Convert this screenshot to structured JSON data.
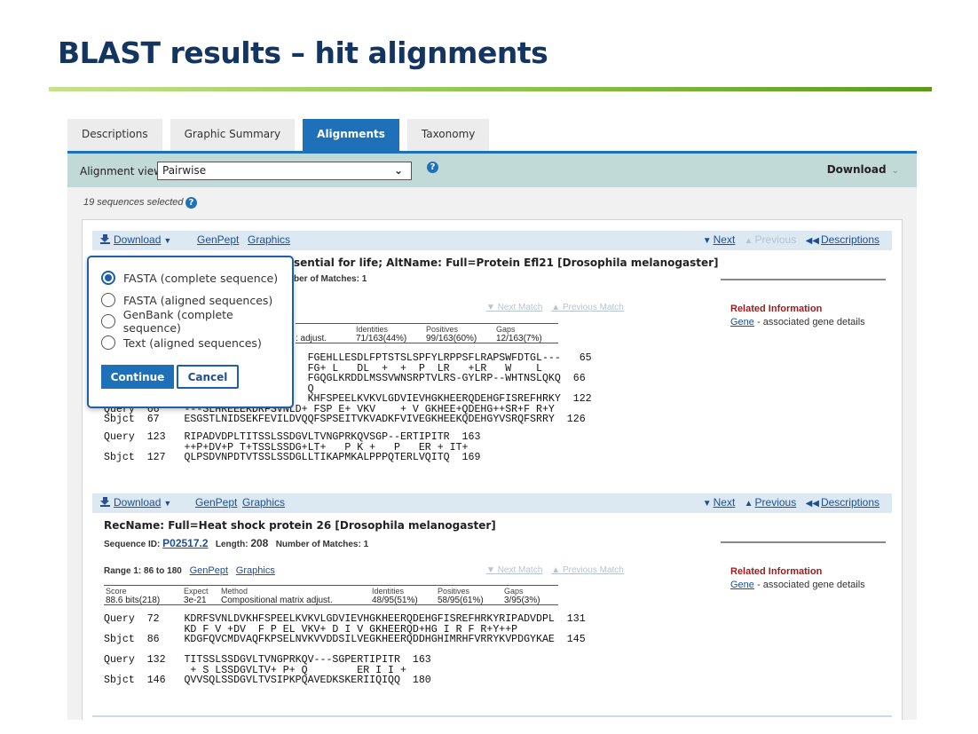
{
  "slide": {
    "title": "BLAST results – hit alignments"
  },
  "tabs": [
    {
      "label": "Descriptions",
      "active": false
    },
    {
      "label": "Graphic Summary",
      "active": false
    },
    {
      "label": "Alignments",
      "active": true
    },
    {
      "label": "Taxonomy",
      "active": false
    }
  ],
  "view_bar": {
    "label": "Alignment view",
    "selected": "Pairwise",
    "help_icon": "question-circle-icon",
    "download_label": "Download"
  },
  "selection": {
    "text": "19 sequences selected"
  },
  "hit_toolbar": {
    "download_label": "Download",
    "genpept_label": "GenPept",
    "graphics_label": "Graphics",
    "next_label": "Next",
    "previous_label": "Previous",
    "descriptions_label": "Descriptions"
  },
  "hits": [
    {
      "title_visible": "sential for life; AltName: Full=Protein Efl21 [Drosophila melanogaster]",
      "matches_label": "Number of Matches:",
      "matches_visible_prefix": "ber of Matches:",
      "matches": "1",
      "next_match": "Next Match",
      "previous_match": "Previous Match",
      "score_headers": {
        "identities": "Identities",
        "positives": "Positives",
        "gaps": "Gaps"
      },
      "method_partial": ": adjust.",
      "identities": "71/163(44%)",
      "positives": "99/163(60%)",
      "gaps": "12/163(7%)",
      "alignment_partial": [
        "                                 FGEHLLESDLFPTSTSLSPFYLRPPSFLRAPSWFDTGL---   65",
        "                                 FG+ L   DL  +  +  P  LR   +LR   W    L",
        "                                 FGQGLKRDDLMSSVWNSRPTVLRS-GYLRP--WHTNSLQKQ  66",
        "                                 Q",
        "                                 KHFSPEELKVKVLGDVIEVHGKHEERQDEHGFISREFHRKY  122",
        "Query  66    ---SLHREEEKDRFSVNLD+ FSP E+ VKV    + V GKHEE+QDEHG++SR+F R+Y",
        "Sbjct  67    ESGSTLNIDSEKFEVILDVQQFSPSEITVKVADKFVIVEGKHEEKQDEHGYVSRQFSRRY  126"
      ],
      "alignment_rest": [
        "Query  123   RIPADVDPLTITSSLSSDGVLTVNGPRKQVSGP--ERTIPITR  163",
        "             ++P+DV+P T+TSSLSSDG+LT+   P K +   P   ER + IT+",
        "Sbjct  127   QLPSDVNPDTVTSSLSSDGLLTIKAPMKALPPPQTERLVQITQ  169"
      ],
      "related": {
        "heading": "Related Information",
        "link": "Gene",
        "text": " - associated gene details"
      }
    },
    {
      "title": "RecName: Full=Heat shock protein 26 [Drosophila melanogaster]",
      "seq_id_label": "Sequence ID:",
      "seq_id": "P02517.2",
      "length_label": "Length:",
      "length": "208",
      "matches_label": "Number of Matches:",
      "matches": "1",
      "range": "Range 1: 86 to 180",
      "genpept_label": "GenPept",
      "graphics_label": "Graphics",
      "next_match": "Next Match",
      "previous_match": "Previous Match",
      "score_headers": {
        "score": "Score",
        "expect": "Expect",
        "method": "Method",
        "identities": "Identities",
        "positives": "Positives",
        "gaps": "Gaps"
      },
      "score": "88.6 bits(218)",
      "expect": "3e-21",
      "method": "Compositional matrix adjust.",
      "identities": "48/95(51%)",
      "positives": "58/95(61%)",
      "gaps": "3/95(3%)",
      "alignment": [
        "Query  72    KDRFSVNLDVKHFSPEELKVKVLGDVIEVHGKHEERQDEHGFISREFHRKYRIPADVDPL  131",
        "             KD F V +DV  F P EL VKV+ D I V GKHEERQD+HG I R F R+Y++P",
        "Sbjct  86    KDGFQVCMDVAQFKPSELNVKVVDDSILVEGKHEERQDDHGHIMRHFVRRYKVPDGYKAE  145",
        "",
        "Query  132   TITSSLSSDGVLTVNGPRKQV---SGPERTIPITR  163",
        "              + S LSSDGVLTV+ P+ Q        ER I I +",
        "Sbjct  146   QVVSQLSSDGVLTVSIPKPQAVEDKSKERIIQIQQ  180"
      ],
      "related": {
        "heading": "Related Information",
        "link": "Gene",
        "text": " - associated gene details"
      }
    }
  ],
  "download_popup": {
    "options": [
      {
        "label": "FASTA (complete sequence)",
        "selected": true
      },
      {
        "label": "FASTA (aligned sequences)",
        "selected": false
      },
      {
        "label": "GenBank (complete sequence)",
        "selected": false
      },
      {
        "label": "Text (aligned sequences)",
        "selected": false
      }
    ],
    "continue_label": "Continue",
    "cancel_label": "Cancel"
  },
  "colors": {
    "title": "#13355f",
    "accent_blue": "#1e70b8",
    "link": "#1e4f8f",
    "bar_teal": "#c1d9d7",
    "related_heading": "#9b1b1b"
  }
}
